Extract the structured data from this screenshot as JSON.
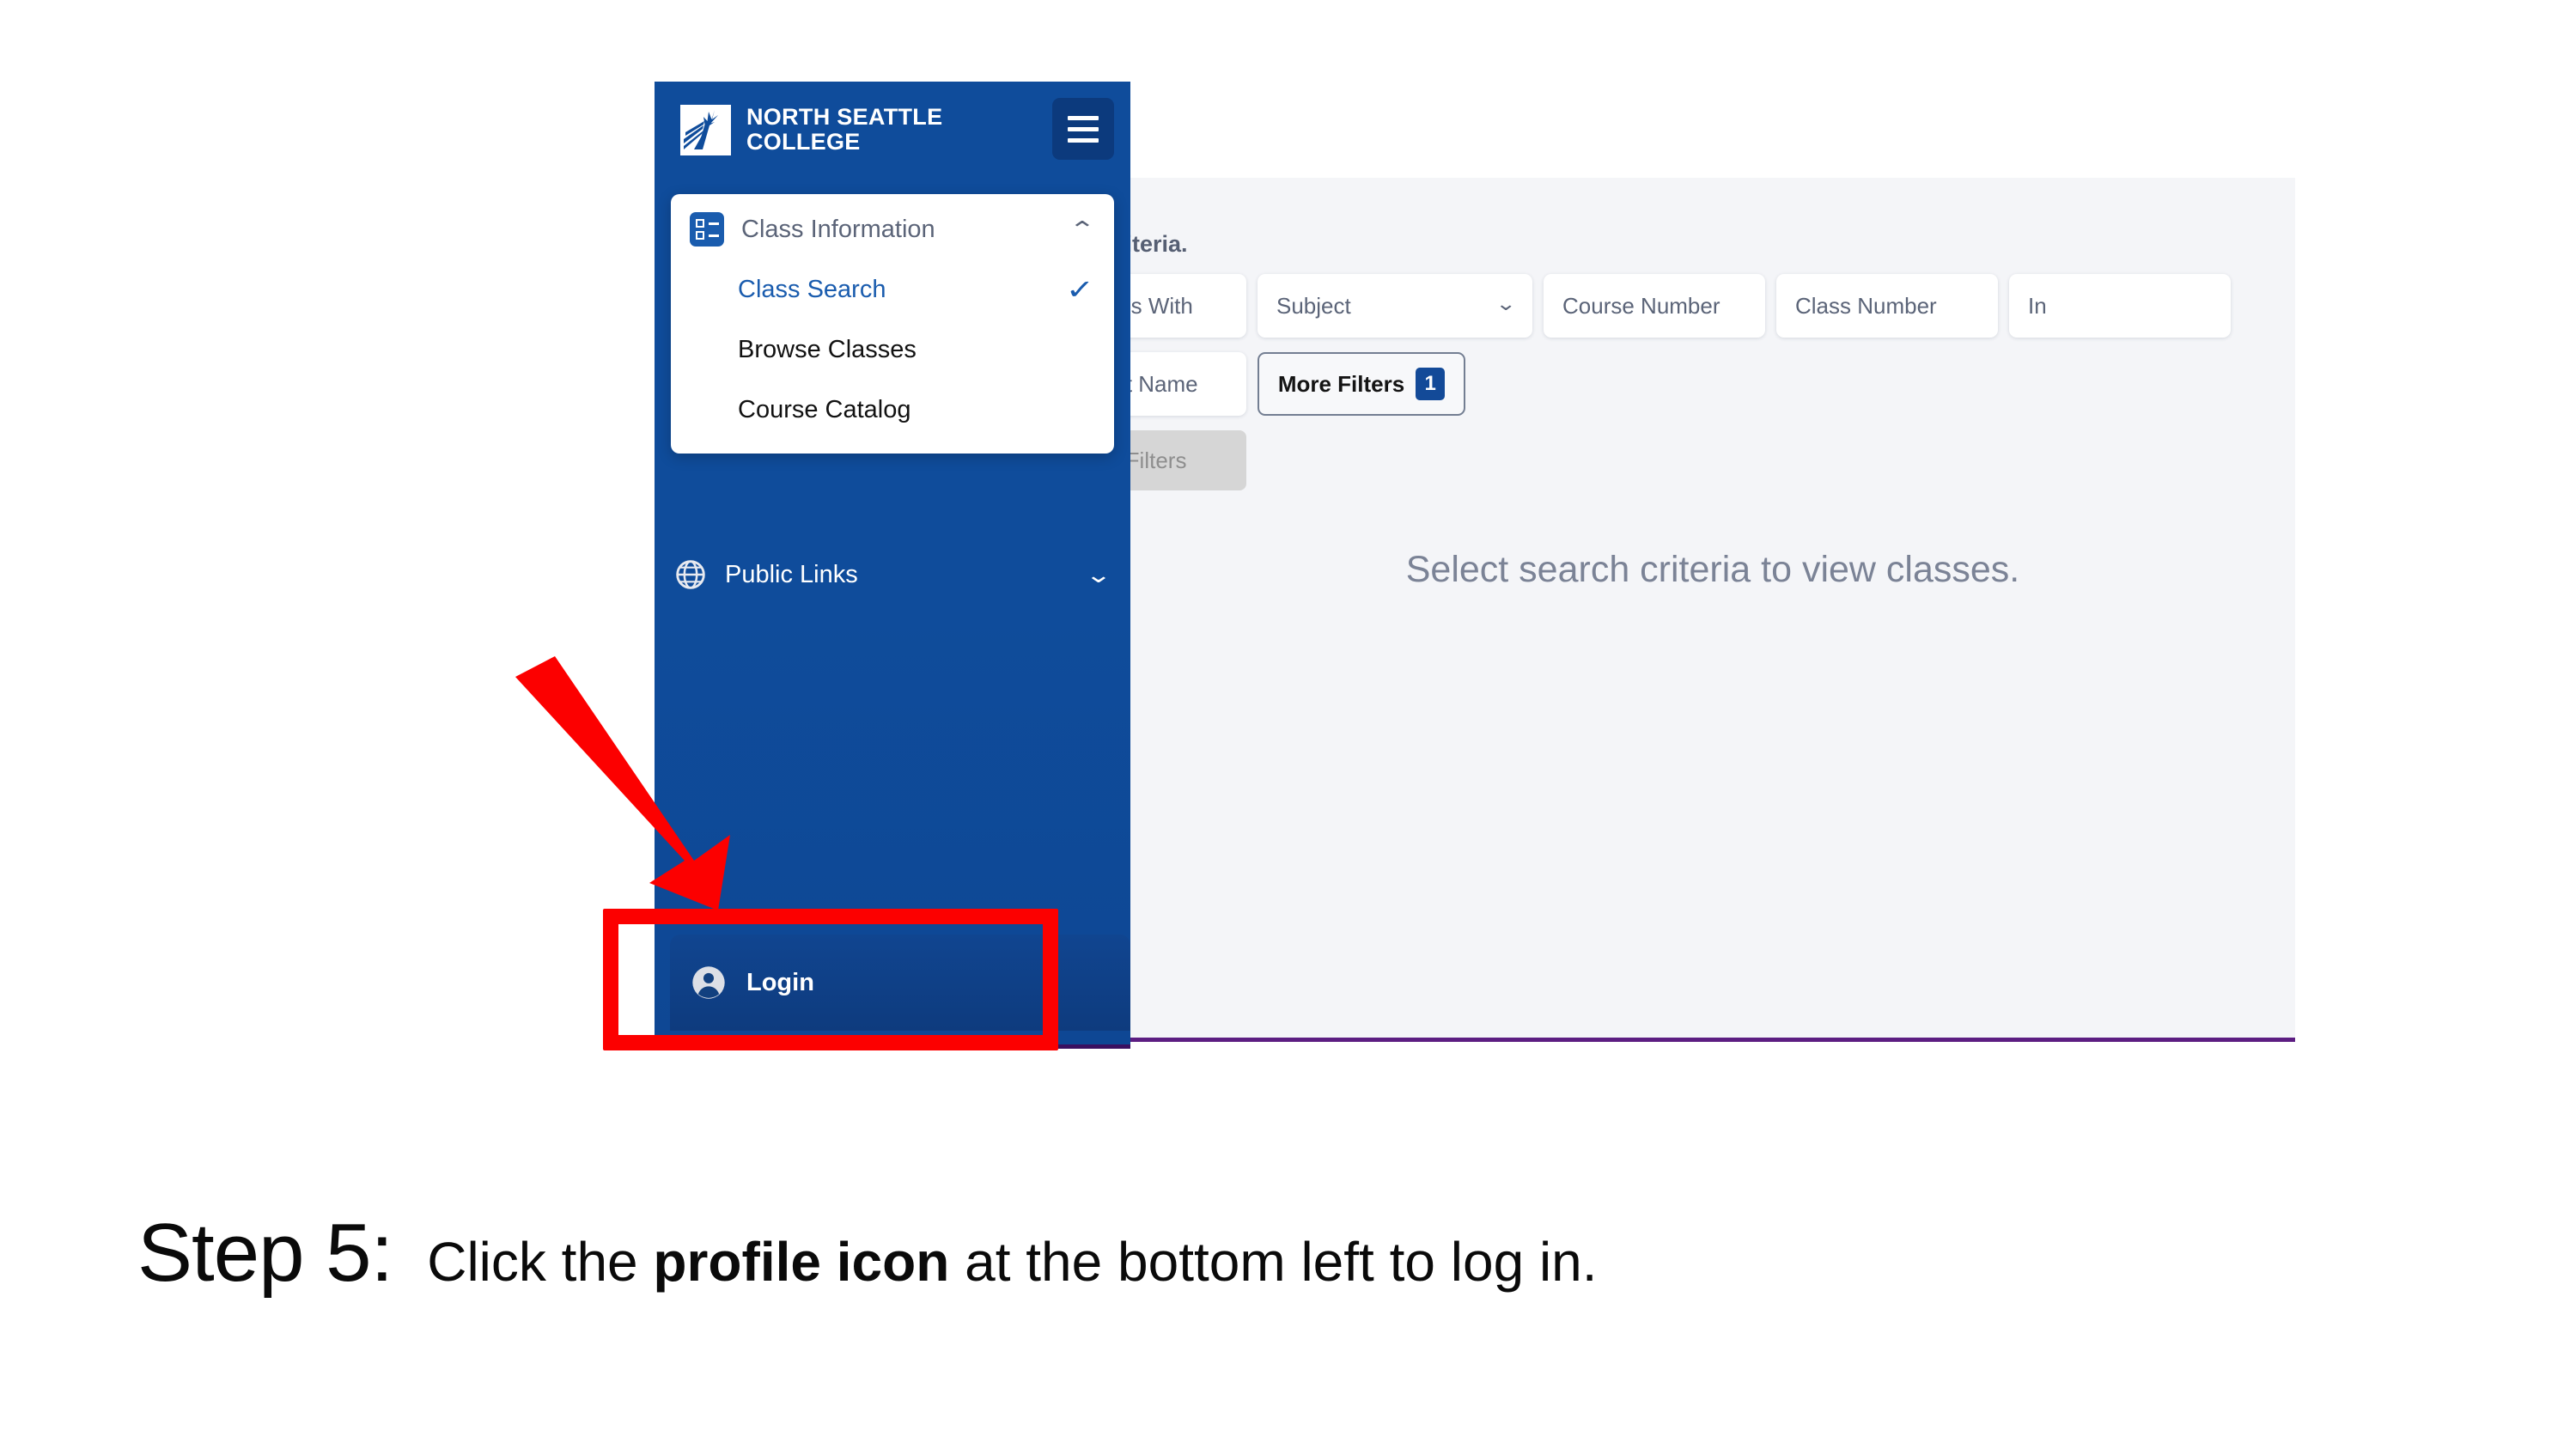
{
  "app": {
    "brand": {
      "line1": "NORTH SEATTLE",
      "line2": "COLLEGE",
      "logo_icon": "comet-star-logo",
      "menu_icon": "hamburger-menu-icon"
    },
    "sidebar": {
      "class_information": {
        "label": "Class Information",
        "icon": "list-grid-icon",
        "caret": "⌃",
        "expanded": true,
        "items": [
          {
            "label": "Class Search",
            "selected": true,
            "check": "✓"
          },
          {
            "label": "Browse Classes",
            "selected": false,
            "check": ""
          },
          {
            "label": "Course Catalog",
            "selected": false,
            "check": ""
          }
        ]
      },
      "public_links": {
        "label": "Public Links",
        "icon": "globe-icon",
        "caret": "⌄",
        "expanded": false
      },
      "login": {
        "label": "Login",
        "icon": "person-circle-icon"
      }
    },
    "content": {
      "criteria_note": "riteria.",
      "filters_row1": [
        {
          "name": "subject-begins-with",
          "label": "oject Begins With",
          "type": "text"
        },
        {
          "name": "subject",
          "label": "Subject",
          "type": "select",
          "caret": "⌄"
        },
        {
          "name": "course-number",
          "label": "Course Number",
          "type": "text"
        },
        {
          "name": "class-number",
          "label": "Class Number",
          "type": "text"
        },
        {
          "name": "instructor",
          "label": "In",
          "type": "text"
        }
      ],
      "filters_row2": [
        {
          "name": "instructor-last-name",
          "label": "tructor Last Name",
          "type": "text"
        }
      ],
      "more_filters": {
        "label": "More Filters",
        "count": "1"
      },
      "reset_filters": {
        "label": "Reset Filters",
        "disabled": true
      },
      "empty_message": "Select search criteria to view classes."
    },
    "colors": {
      "sidebar_blue": "#0f4c9b",
      "accent_blue": "#1a5cae",
      "badge_blue": "#134a98",
      "content_bg": "#f4f5f8",
      "bottom_rule_purple": "#5c1d82",
      "annotation_red": "#fc0000"
    }
  },
  "annotations": {
    "arrow": {
      "name": "red-arrow-pointing-to-login",
      "color": "#fc0000"
    },
    "highlight_box": {
      "name": "red-highlight-box-around-login",
      "color": "#fc0000"
    }
  },
  "caption": {
    "step_label": "Step 5:",
    "text_before": "Click the ",
    "text_bold": "profile icon",
    "text_after": " at the bottom left to log in."
  }
}
